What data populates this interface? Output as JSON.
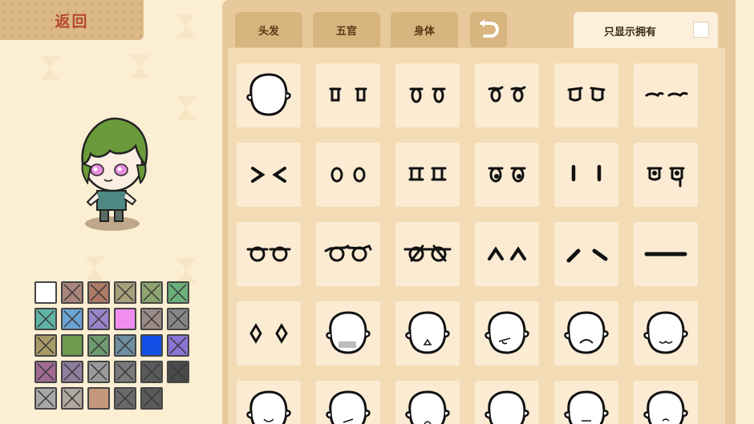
{
  "back_button": {
    "label": "返回"
  },
  "tabs": [
    {
      "label": "头发"
    },
    {
      "label": "五官"
    },
    {
      "label": "身体"
    }
  ],
  "filter": {
    "label": "只显示拥有",
    "checked": false
  },
  "swatches": [
    {
      "color": "#ffffff",
      "locked": false
    },
    {
      "color": "#a8857d",
      "locked": true
    },
    {
      "color": "#ad7a66",
      "locked": true
    },
    {
      "color": "#a8a07a",
      "locked": true
    },
    {
      "color": "#8da570",
      "locked": true
    },
    {
      "color": "#6ab07a",
      "locked": true
    },
    {
      "color": "#5fb3a6",
      "locked": true
    },
    {
      "color": "#6aa4d4",
      "locked": true
    },
    {
      "color": "#9a84c9",
      "locked": true
    },
    {
      "color": "#f08ef0",
      "locked": false
    },
    {
      "color": "#9a8a86",
      "locked": true
    },
    {
      "color": "#868686",
      "locked": true
    },
    {
      "color": "#a89a66",
      "locked": true
    },
    {
      "color": "#6e9a4e",
      "locked": false
    },
    {
      "color": "#6e9a70",
      "locked": true
    },
    {
      "color": "#6f8ea0",
      "locked": true
    },
    {
      "color": "#1450e6",
      "locked": false
    },
    {
      "color": "#8a74d4",
      "locked": true
    },
    {
      "color": "#a06a92",
      "locked": true
    },
    {
      "color": "#8e7e9e",
      "locked": true
    },
    {
      "color": "#9a9a9a",
      "locked": true
    },
    {
      "color": "#7a7a7a",
      "locked": true
    },
    {
      "color": "#5a5a5a",
      "locked": true
    },
    {
      "color": "#4a4a4a",
      "locked": true
    },
    {
      "color": "#a8a8a8",
      "locked": true
    },
    {
      "color": "#b0a8a0",
      "locked": true
    },
    {
      "color": "#c4987a",
      "locked": false
    },
    {
      "color": "#6a6a6a",
      "locked": true
    },
    {
      "color": "#5a5a5a",
      "locked": true
    }
  ],
  "items": [
    "face-blank",
    "eyes-tall",
    "eyes-round",
    "eyes-lashes",
    "eyes-lashes-2",
    "eyes-sleepy",
    "eyes-squint",
    "eyes-oval",
    "eyes-square",
    "eyes-shine",
    "eyes-lines",
    "eyes-tear",
    "eyes-wide",
    "eyes-wide-lashes",
    "eyes-cross",
    "eyes-happy",
    "eyes-angry",
    "eyes-line",
    "eyes-diamond",
    "face-bandage",
    "face-mouth-small",
    "face-tongue",
    "face-frown",
    "face-cat-mouth",
    "face-row5-1",
    "face-row5-2",
    "face-row5-3",
    "face-row5-4",
    "face-row5-5",
    "face-row5-6"
  ]
}
